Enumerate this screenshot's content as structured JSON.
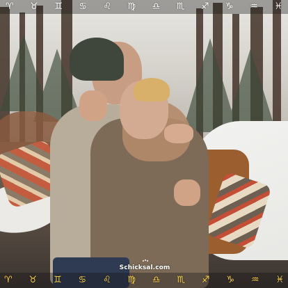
{
  "image": {
    "alt": "Couple hugging in a snowy forest"
  },
  "top_zodiac_bar": {
    "symbols": [
      "♈",
      "♉",
      "♊",
      "♋",
      "♌",
      "♍",
      "♎",
      "♏",
      "♐",
      "♑",
      "♒",
      "♓"
    ],
    "symbol_names": [
      "aries-icon",
      "taurus-icon",
      "gemini-icon",
      "cancer-icon",
      "leo-icon",
      "virgo-icon",
      "libra-icon",
      "scorpio-icon",
      "sagittarius-icon",
      "capricorn-icon",
      "aquarius-icon",
      "pisces-icon"
    ],
    "color": "#ffffff"
  },
  "bottom_zodiac_bar": {
    "symbols": [
      "♈",
      "♉",
      "♊",
      "♋",
      "♌",
      "♍",
      "♎",
      "♏",
      "♐",
      "♑",
      "♒",
      "♓"
    ],
    "symbol_names": [
      "aries-icon",
      "taurus-icon",
      "gemini-icon",
      "cancer-icon",
      "leo-icon",
      "virgo-icon",
      "libra-icon",
      "scorpio-icon",
      "sagittarius-icon",
      "capricorn-icon",
      "aquarius-icon",
      "pisces-icon"
    ],
    "color": "#ffd24a"
  },
  "watermark": {
    "text": "Schicksal.com"
  }
}
